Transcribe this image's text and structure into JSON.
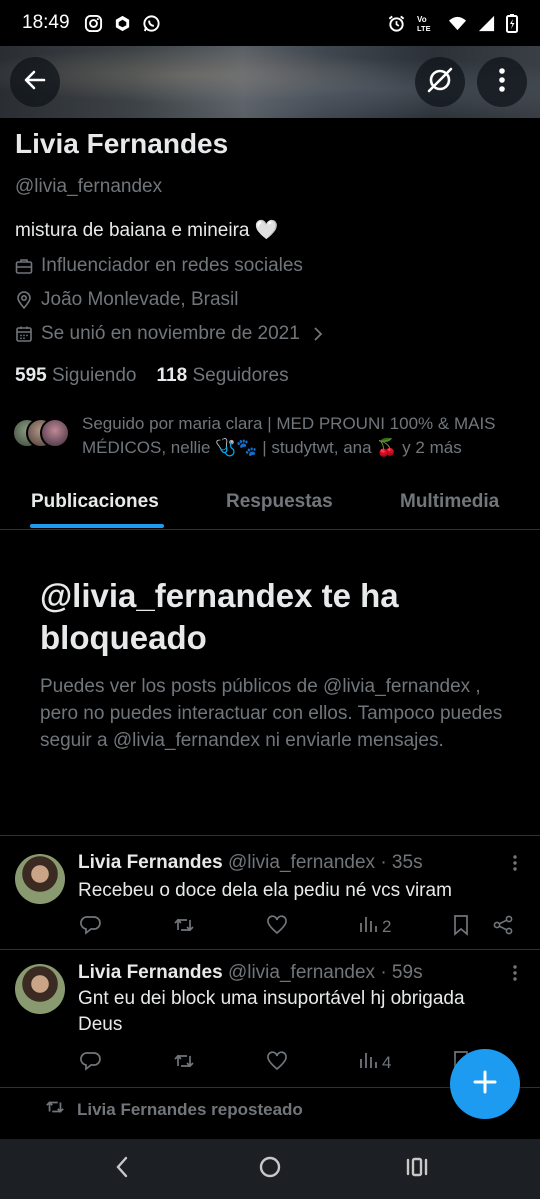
{
  "status_bar": {
    "time": "18:49",
    "left_icons": [
      "instagram-icon",
      "dropbox-icon",
      "whatsapp-icon"
    ],
    "right_icons": [
      "alarm-icon",
      "volte-icon",
      "wifi-icon",
      "signal-icon",
      "battery-icon"
    ],
    "volte_label": "Vo LTE"
  },
  "header": {
    "back_icon": "arrow-left-icon",
    "grok_icon": "grok-slash-icon",
    "more_icon": "more-vertical-icon"
  },
  "profile": {
    "name": "Livia Fernandes",
    "handle": "@livia_fernandex",
    "bio": "mistura de baiana e mineira 🤍",
    "category": "Influenciador en redes sociales",
    "location": "João Monlevade, Brasil",
    "joined": "Se unió en noviembre de 2021",
    "following_count": "595",
    "following_label": "Siguiendo",
    "followers_count": "118",
    "followers_label": "Seguidores",
    "followed_by": "Seguido por maria clara | MED PROUNI 100% & MAIS MÉDICOS, nellie 🩺🐾 | studytwt, ana 🍒 y 2 más"
  },
  "tabs": [
    {
      "label": "Publicaciones",
      "active": true
    },
    {
      "label": "Respuestas",
      "active": false
    },
    {
      "label": "Multimedia",
      "active": false
    }
  ],
  "blocked": {
    "title": "@livia_fernandex te ha bloqueado",
    "text": "Puedes ver los posts públicos de @livia_fernandex , pero no puedes interactuar con ellos. Tampoco puedes seguir a @livia_fernandex ni enviarle mensajes."
  },
  "posts": [
    {
      "author": "Livia Fernandes",
      "handle": "@livia_fernandex",
      "time": "· 35s",
      "text": "Recebeu o doce dela ela pediu né vcs viram",
      "views": "2"
    },
    {
      "author": "Livia Fernandes",
      "handle": "@livia_fernandex",
      "time": "· 59s",
      "text": "Gnt eu dei block uma insuportável hj obrigada Deus",
      "views": "4"
    }
  ],
  "repost_label": "Livia Fernandes reposteado",
  "colors": {
    "accent": "#1d9bf0",
    "background": "#000000",
    "text_primary": "#e7e9ea",
    "text_secondary": "#71767b",
    "divider": "#2f3336"
  }
}
